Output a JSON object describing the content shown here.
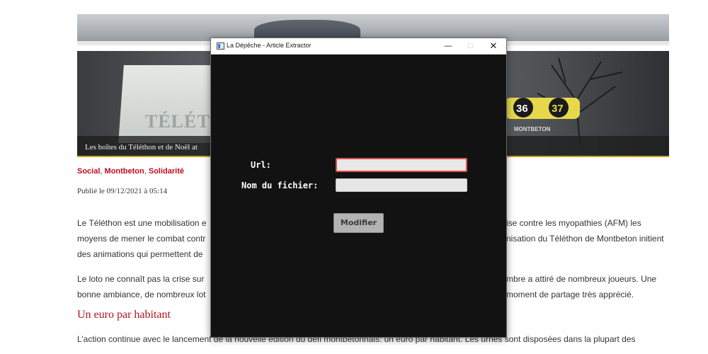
{
  "article": {
    "caption": "Les boîtes du Téléthon et de Noël at",
    "banner_text": "TÉLÉTH",
    "hero_logo_text": "MONTBETON",
    "tags": [
      "Social",
      "Montbeton",
      "Solidarité"
    ],
    "published": "Publié le 09/12/2021 à 05:14",
    "paragraph1_left": [
      "Le Téléthon est une mobilisation e",
      "moyens de mener le combat contr",
      "des animations qui permettent de"
    ],
    "paragraph1_right": [
      "ise contre les myopathies (AFM) les",
      "nisation du Téléthon de Montbeton initient"
    ],
    "paragraph2_left": [
      "Le loto ne connaît pas la crise sur",
      "bonne ambiance, de nombreux lot"
    ],
    "paragraph2_right": [
      "mbre a attiré de nombreux joueurs. Une",
      "moment de partage très apprécié."
    ],
    "subheading": "Un euro par habitant",
    "paragraph3": "L’action continue avec le lancement de la nouvelle édition du défi montbétonnais: un euro par habitant. Les urnes sont disposées dans la plupart des"
  },
  "dialog": {
    "title": "La Dépêche - Article Extractor",
    "minimize": "—",
    "maximize": "□",
    "close": "✕",
    "url_label": "Url:",
    "url_value": "",
    "filename_label": "Nom du fichier:",
    "filename_value": "",
    "submit_label": "Modifier"
  },
  "colors": {
    "tag_red": "#c00b1f",
    "subhead_red": "#b5121b",
    "dialog_bg": "#121212",
    "error_border": "#e0504a"
  }
}
